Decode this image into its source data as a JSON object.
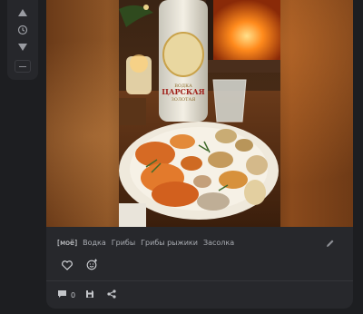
{
  "sidebar": {
    "buttons": [
      {
        "name": "up",
        "icon": "arrow-up-icon"
      },
      {
        "name": "history",
        "icon": "clock-icon"
      },
      {
        "name": "down",
        "icon": "arrow-down-icon"
      },
      {
        "name": "minimize",
        "icon": "minus-icon"
      }
    ]
  },
  "post": {
    "image": {
      "bottle_label_top": "ВОДКА",
      "bottle_label_main": "ЦАРСКАЯ",
      "bottle_label_bottom": "ЗОЛОТАЯ"
    },
    "tags": [
      "[моё]",
      "Водка",
      "Грибы",
      "Грибы рыжики",
      "Засолка"
    ],
    "comments_count": "0",
    "icons": {
      "edit": "pencil-icon",
      "like": "heart-icon",
      "reaction": "smile-plus-icon",
      "comments": "comment-icon",
      "save": "save-icon",
      "share": "share-icon"
    }
  },
  "colors": {
    "background": "#1d1e21",
    "card": "#27282c",
    "icon": "#b8bbc0"
  }
}
